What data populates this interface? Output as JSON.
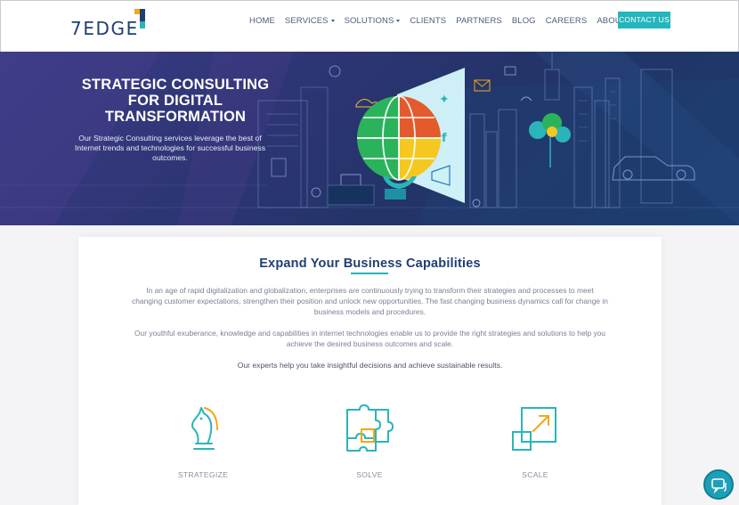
{
  "brand": {
    "logo_text": "7EDGE"
  },
  "nav": {
    "items": [
      {
        "label": "HOME",
        "dropdown": false
      },
      {
        "label": "SERVICES",
        "dropdown": true
      },
      {
        "label": "SOLUTIONS",
        "dropdown": true
      },
      {
        "label": "CLIENTS",
        "dropdown": false
      },
      {
        "label": "PARTNERS",
        "dropdown": false
      },
      {
        "label": "BLOG",
        "dropdown": false
      },
      {
        "label": "CAREERS",
        "dropdown": false
      },
      {
        "label": "ABOUT US",
        "dropdown": true
      }
    ],
    "contact_label": "CONTACT US"
  },
  "hero": {
    "title": "STRATEGIC CONSULTING FOR DIGITAL TRANSFORMATION",
    "subtitle": "Our Strategic Consulting services leverage the best of Internet trends and technologies for successful business outcomes."
  },
  "section": {
    "title": "Expand Your Business Capabilities",
    "para1": "In an age of rapid digitalization and globalization, enterprises are continuously trying to transform their strategies and processes to meet changing customer expectations, strengthen their position and unlock new opportunities. The fast changing business dynamics call for change in business models and procedures.",
    "para2": "Our youthful exuberance, knowledge and capabilities in internet technologies enable us to provide the right strategies and solutions to help you achieve the desired business outcomes and scale.",
    "para3": "Our experts help you take insightful decisions and achieve sustainable results."
  },
  "features": [
    {
      "label": "STRATEGIZE",
      "icon": "chess-knight-icon"
    },
    {
      "label": "SOLVE",
      "icon": "puzzle-icon"
    },
    {
      "label": "SCALE",
      "icon": "scale-arrow-icon"
    }
  ],
  "colors": {
    "brand_navy": "#1f3f73",
    "accent_teal": "#25b5bd",
    "accent_yellow": "#f2a61b",
    "hero_bg": "#2e3575"
  }
}
